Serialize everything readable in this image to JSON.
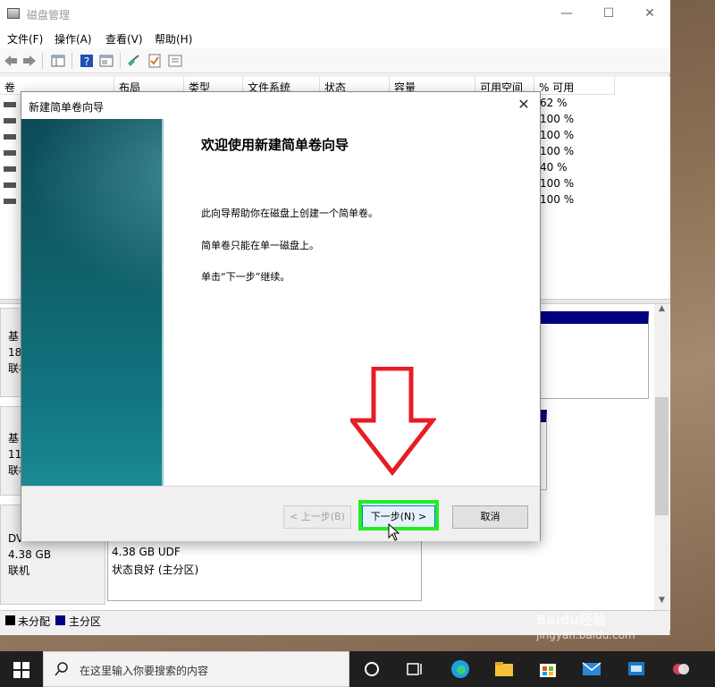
{
  "window": {
    "title": "磁盘管理",
    "min": "—",
    "max": "☐",
    "close": "✕"
  },
  "menu": [
    "文件(F)",
    "操作(A)",
    "查看(V)",
    "帮助(H)"
  ],
  "columns": [
    "卷",
    "布局",
    "类型",
    "文件系统",
    "状态",
    "容量",
    "可用空间",
    "% 可用"
  ],
  "pct_values": [
    "62 %",
    "100 %",
    "100 %",
    "100 %",
    "40 %",
    "100 %",
    "100 %"
  ],
  "disks": [
    {
      "l1": "基",
      "l2": "18",
      "l3": "联机"
    },
    {
      "l1": "基",
      "l2": "11",
      "l3": "联机"
    },
    {
      "l1": "DV",
      "l2": "4.38 GB",
      "l3": "联机"
    }
  ],
  "dvd_partition": {
    "size": "4.38 GB UDF",
    "status": "状态良好 (主分区)"
  },
  "legend": {
    "unallocated": "未分配",
    "primary": "主分区",
    "unallocated_color": "#000000",
    "primary_color": "#000080"
  },
  "dialog": {
    "title": "新建简单卷向导",
    "close": "✕",
    "heading": "欢迎使用新建简单卷向导",
    "line1": "此向导帮助你在磁盘上创建一个简单卷。",
    "line2": "简单卷只能在单一磁盘上。",
    "line3": "单击“下一步”继续。",
    "back_label": "< 上一步(B)",
    "next_label": "下一步(N) >",
    "cancel_label": "取消"
  },
  "taskbar": {
    "search_placeholder": "在这里输入你要搜索的内容"
  },
  "watermark": "Baidu经验",
  "watermark_sub": "jingyan.baidu.com",
  "annotations": {
    "arrow_color": "#e81c24",
    "highlight_color": "#22ee22"
  }
}
